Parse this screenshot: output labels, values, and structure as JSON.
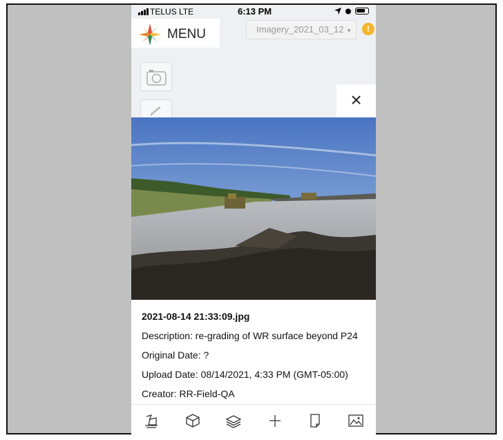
{
  "status_bar": {
    "carrier": "TELUS  LTE",
    "time": "6:13 PM"
  },
  "menu": {
    "label": "MENU"
  },
  "imagery_select": {
    "value": "Imagery_2021_03_12"
  },
  "warning": {
    "symbol": "!"
  },
  "close": {
    "symbol": "×"
  },
  "photo_details": {
    "filename": "2021-08-14 21:33:09.jpg",
    "description": "Description: re-grading of WR surface beyond P24",
    "original_date": "Original Date: ?",
    "upload_date": "Upload Date: 08/14/2021, 4:33 PM (GMT-05:00)",
    "creator": "Creator: RR-Field-QA"
  },
  "toolbar": {
    "items": [
      "survey-tool-icon",
      "cube-icon",
      "layers-icon",
      "crosshair-icon",
      "document-icon",
      "image-icon"
    ]
  },
  "colors": {
    "warning": "#f3b62c",
    "background": "#c0c0c0"
  }
}
